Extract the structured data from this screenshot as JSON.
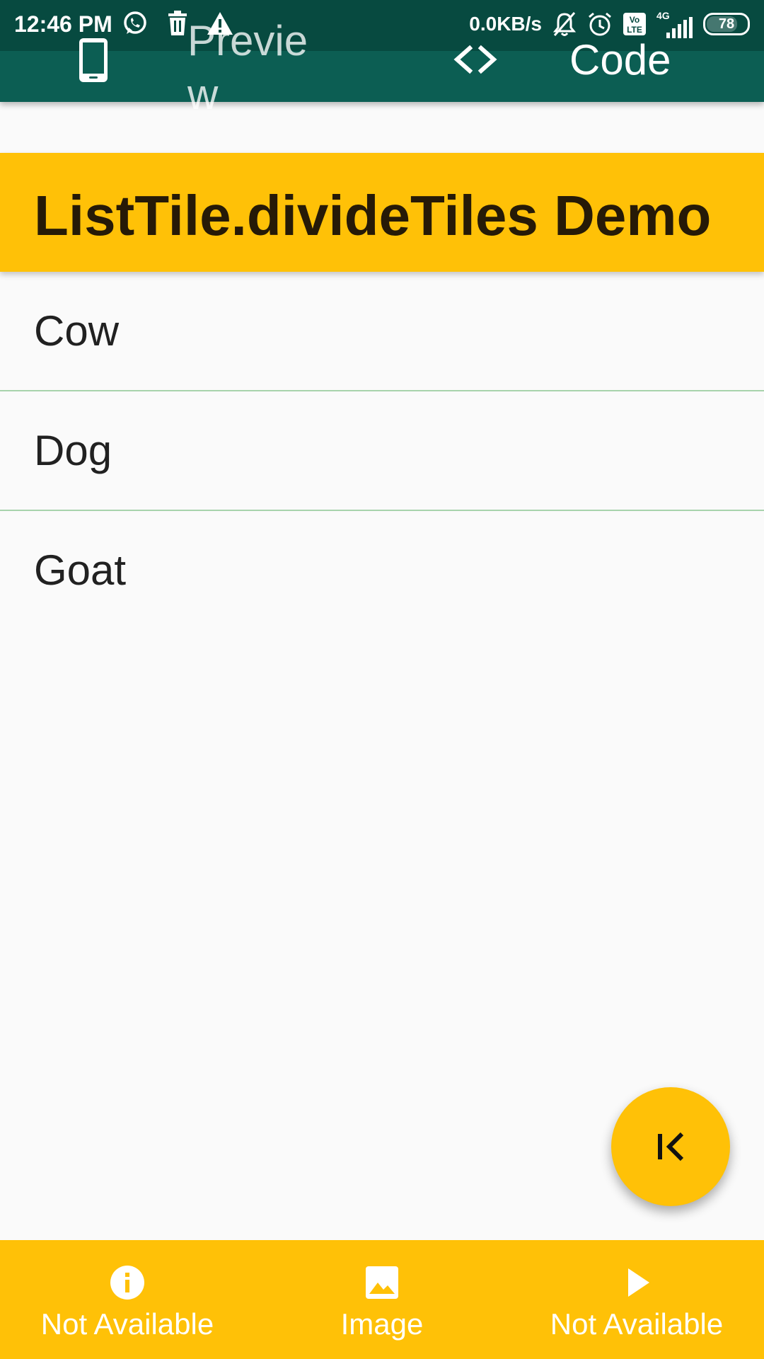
{
  "status_bar": {
    "time": "12:46 PM",
    "net_speed": "0.0KB/s",
    "network_type": "4G",
    "battery_level": "78",
    "battery_fraction": 0.78,
    "left_icons": [
      "whatsapp-icon",
      "delete-icon",
      "warning-icon"
    ],
    "right_icons": [
      "muted-bell-icon",
      "alarm-icon",
      "volte-icon",
      "signal-icon",
      "battery-icon"
    ]
  },
  "tab_bar": {
    "tabs": [
      {
        "icon": "phone-icon",
        "label": "Preview",
        "active": false
      },
      {
        "icon": "code-icon",
        "label": "Code",
        "active": true
      }
    ]
  },
  "demo": {
    "title": "ListTile.divideTiles Demo",
    "items": [
      "Cow",
      "Dog",
      "Goat"
    ]
  },
  "fab": {
    "icon": "first-page-icon"
  },
  "bottom_nav": {
    "items": [
      {
        "icon": "info-icon",
        "label": "Not Available"
      },
      {
        "icon": "image-icon",
        "label": "Image"
      },
      {
        "icon": "play-icon",
        "label": "Not Available"
      }
    ]
  },
  "colors": {
    "status_bar": "#074a40",
    "tab_bar": "#0c5e53",
    "accent": "#ffc107",
    "divider": "#a8d3ac",
    "background": "#fafafa",
    "text": "#212121"
  }
}
